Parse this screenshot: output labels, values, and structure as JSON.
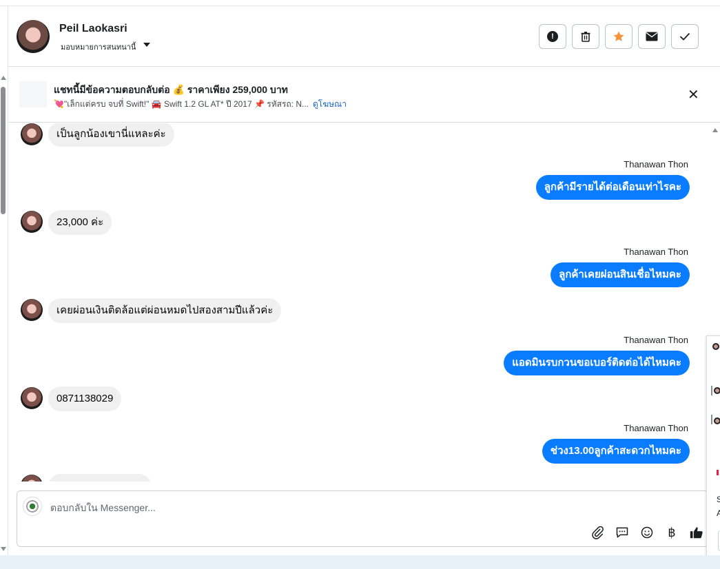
{
  "header": {
    "contact_name": "Peil Laokasri",
    "assign_label": "มอบหมายการสนทนานี้",
    "actions": [
      {
        "icon": "alert-icon",
        "glyph": "!"
      },
      {
        "icon": "trash-icon",
        "glyph": "🗑"
      },
      {
        "icon": "star-icon",
        "glyph": "★"
      },
      {
        "icon": "mail-icon",
        "glyph": "✉"
      },
      {
        "icon": "check-icon",
        "glyph": "✓"
      }
    ]
  },
  "ad_banner": {
    "title": "แชทนี้มีข้อความตอบกลับต่อ 💰 ราคาเพียง 259,000 บาท",
    "subtitle": "💘\"เล็กแต่ครบ จบที่ Swift!\" 🚘 Swift 1.2 GL AT* ปี 2017 📌 รหัสรถ: N...",
    "link": "ดูโฆษณา",
    "close_glyph": "✕"
  },
  "messages": [
    {
      "direction": "in",
      "text": "เป็นลูกน้องเขานี่แหละค่ะ"
    },
    {
      "direction": "out",
      "sender": "Thanawan Thon",
      "text": "ลูกค้ามีรายได้ต่อเดือนเท่าไรคะ"
    },
    {
      "direction": "in",
      "text": "23,000 ค่ะ"
    },
    {
      "direction": "out",
      "sender": "Thanawan Thon",
      "text": "ลูกค้าเคยผ่อนสินเชื่อไหมคะ"
    },
    {
      "direction": "in",
      "text": "เคยผ่อนเงินติดล้อแต่ผ่อนหมดไปสองสามปีแล้วค่ะ"
    },
    {
      "direction": "out",
      "sender": "Thanawan Thon",
      "text": "แอดมินรบกวนขอเบอร์ติดต่อได้ไหมคะ"
    },
    {
      "direction": "in",
      "text": "0871138029"
    },
    {
      "direction": "out",
      "sender": "Thanawan Thon",
      "text": "ช่วง13.00ลูกค้าสะดวกไหมคะ"
    }
  ],
  "composer": {
    "placeholder": "ตอบกลับใน Messenger...",
    "tools": [
      {
        "icon": "paperclip-icon",
        "glyph": "📎"
      },
      {
        "icon": "saved-reply-icon",
        "glyph": "💬"
      },
      {
        "icon": "emoji-icon",
        "glyph": "☺"
      },
      {
        "icon": "baht-payment-icon",
        "glyph": "฿"
      },
      {
        "icon": "thumbs-up-icon",
        "glyph": "👍"
      }
    ]
  },
  "side_panel": {
    "letters": [
      "S",
      "A"
    ]
  },
  "colors": {
    "outgoing_bubble": "#0a7cff",
    "incoming_bubble": "#f0f0f0",
    "star": "#f7923b",
    "link": "#1a64c8"
  }
}
